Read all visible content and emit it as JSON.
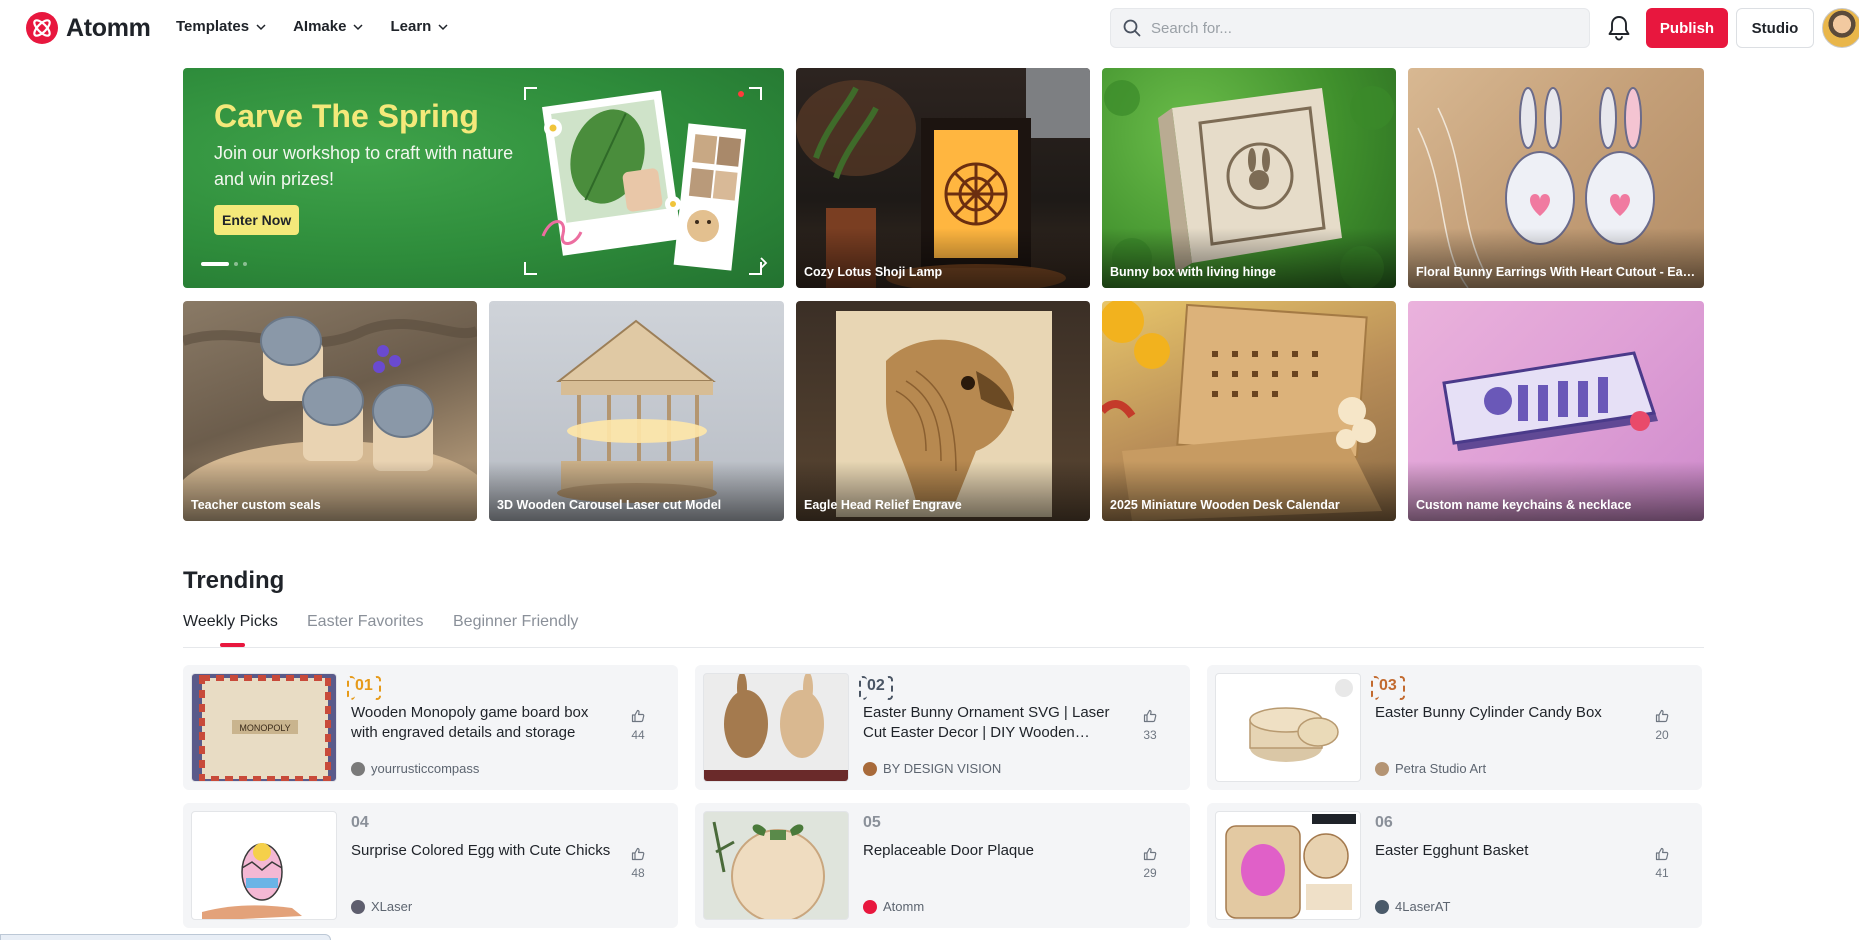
{
  "header": {
    "brand": "Atomm",
    "nav": [
      {
        "label": "Templates",
        "icon": "chevron-down-icon"
      },
      {
        "label": "AImake",
        "icon": "chevron-down-icon"
      },
      {
        "label": "Learn",
        "icon": "chevron-down-icon"
      }
    ],
    "search_placeholder": "Search for...",
    "publish_label": "Publish",
    "studio_label": "Studio"
  },
  "banner": {
    "title": "Carve The Spring",
    "subtitle": "Join our workshop to craft with nature and win prizes!",
    "cta": "Enter Now",
    "slides": 3,
    "active_slide": 1,
    "accent": "#f4e97a"
  },
  "tiles": [
    {
      "caption": "Cozy Lotus Shoji Lamp"
    },
    {
      "caption": "Bunny box with living hinge"
    },
    {
      "caption": "Floral Bunny Earrings With Heart Cutout - East..."
    },
    {
      "caption": "Teacher custom seals"
    },
    {
      "caption": "3D Wooden Carousel Laser cut Model"
    },
    {
      "caption": "Eagle Head Relief Engrave"
    },
    {
      "caption": "2025 Miniature Wooden Desk Calendar"
    },
    {
      "caption": "Custom name keychains & necklace"
    }
  ],
  "trending": {
    "title": "Trending",
    "tabs": [
      "Weekly Picks",
      "Easter Favorites",
      "Beginner Friendly"
    ],
    "active_tab": 0,
    "items": [
      {
        "rank": "01",
        "title": "Wooden Monopoly game board box with engraved details and storage",
        "author": "yourrusticcompass",
        "likes": "44"
      },
      {
        "rank": "02",
        "title": "Easter Bunny Ornament SVG | Laser Cut Easter Decor | DIY Wooden Bunn...",
        "author": "BY DESIGN VISION",
        "likes": "33"
      },
      {
        "rank": "03",
        "title": "Easter Bunny Cylinder Candy Box",
        "author": "Petra Studio Art",
        "likes": "20"
      },
      {
        "rank": "04",
        "title": "Surprise Colored Egg with Cute Chicks",
        "author": "XLaser",
        "likes": "48"
      },
      {
        "rank": "05",
        "title": "Replaceable Door Plaque",
        "author": "Atomm",
        "likes": "29"
      },
      {
        "rank": "06",
        "title": "Easter Egghunt Basket",
        "author": "4LaserAT",
        "likes": "41"
      }
    ]
  },
  "colors": {
    "brand": "#e8173e",
    "gold": "#e69a19",
    "silver": "#4a5564",
    "bronze": "#c26a2f"
  }
}
